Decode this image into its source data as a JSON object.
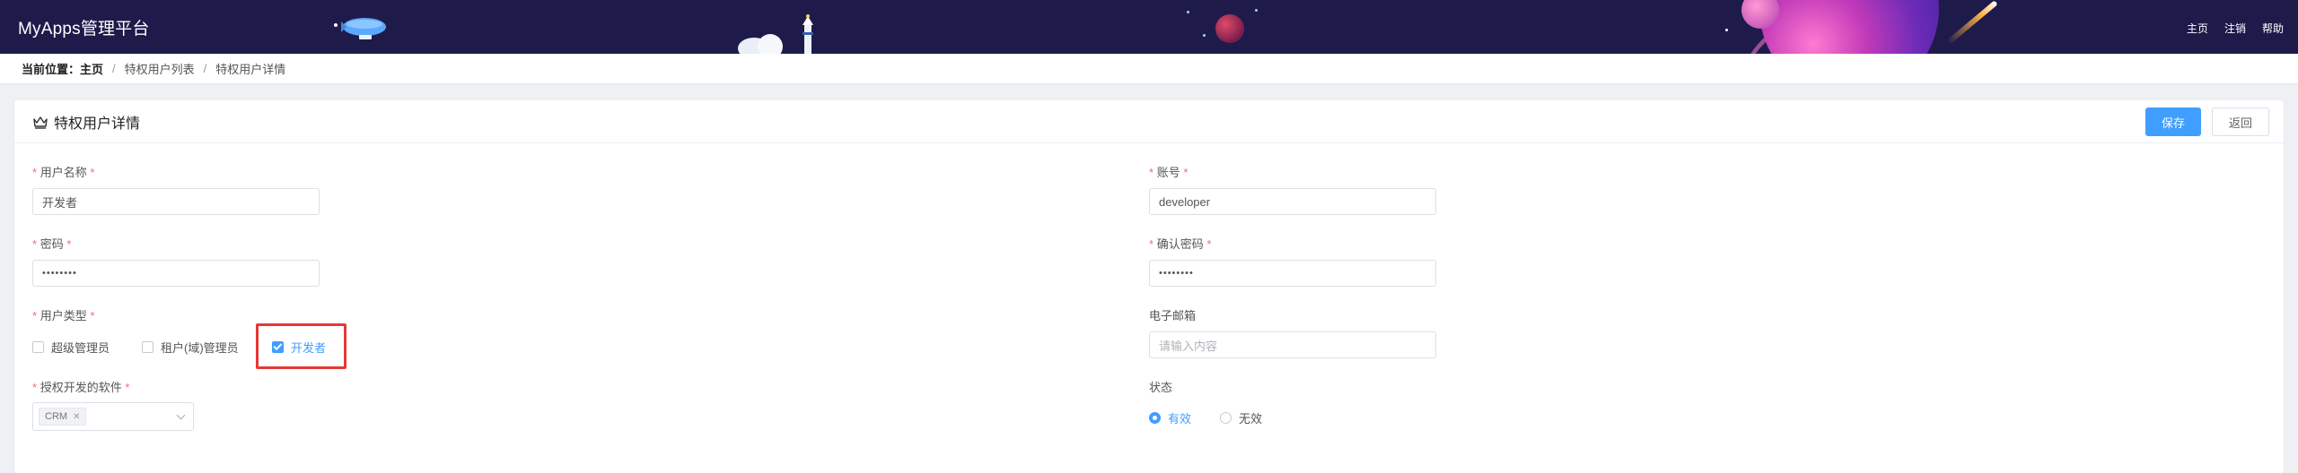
{
  "header": {
    "brand": "MyApps管理平台",
    "nav": [
      "主页",
      "注销",
      "帮助"
    ]
  },
  "breadcrumb": {
    "prefix": "当前位置：",
    "home": "主页",
    "items": [
      "特权用户列表",
      "特权用户详情"
    ],
    "separator": "/"
  },
  "card": {
    "title": "特权用户详情",
    "save_label": "保存",
    "back_label": "返回"
  },
  "form": {
    "username": {
      "label": "用户名称",
      "value": "开发者"
    },
    "account": {
      "label": "账号",
      "value": "developer"
    },
    "password": {
      "label": "密码",
      "value": "••••••••"
    },
    "confirm_password": {
      "label": "确认密码",
      "value": "••••••••"
    },
    "user_type": {
      "label": "用户类型",
      "options": [
        {
          "label": "超级管理员",
          "checked": false
        },
        {
          "label": "租户(域)管理员",
          "checked": false
        },
        {
          "label": "开发者",
          "checked": true
        }
      ]
    },
    "email": {
      "label": "电子邮箱",
      "placeholder": "请输入内容"
    },
    "software": {
      "label": "授权开发的软件",
      "tags": [
        "CRM"
      ]
    },
    "status": {
      "label": "状态",
      "options": [
        {
          "label": "有效",
          "checked": true
        },
        {
          "label": "无效",
          "checked": false
        }
      ]
    },
    "required_mark": "*"
  },
  "colors": {
    "header_bg": "#1e1b4b",
    "primary": "#409eff",
    "required": "#f56c6c",
    "highlight": "#e53935"
  }
}
